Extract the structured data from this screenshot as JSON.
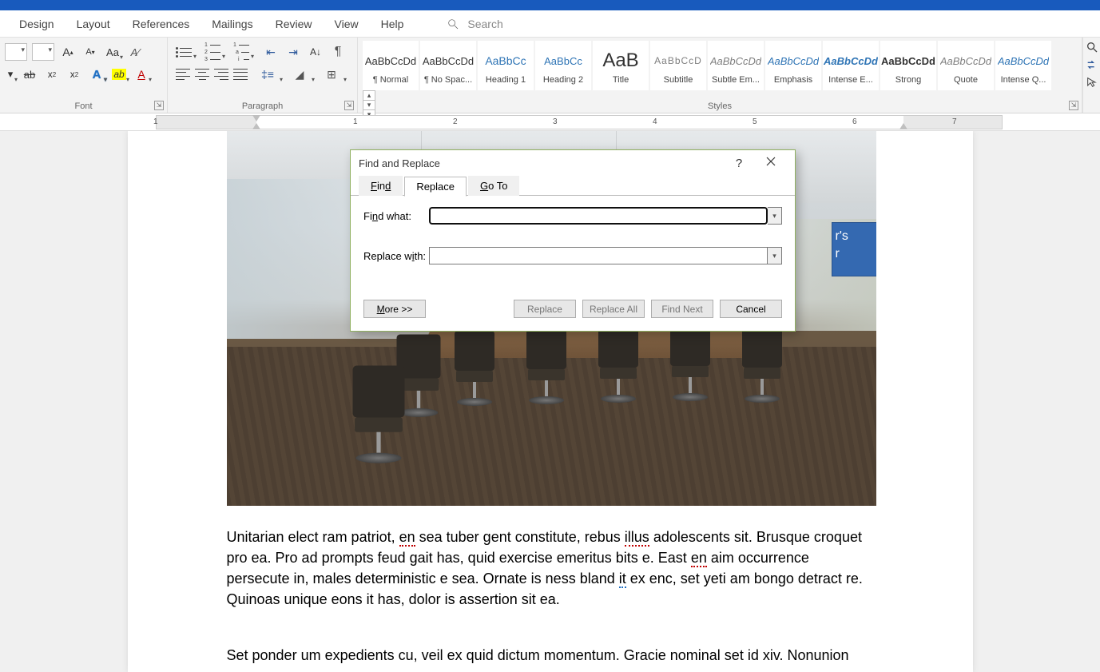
{
  "tabs": {
    "design": "Design",
    "layout": "Layout",
    "references": "References",
    "mailings": "Mailings",
    "review": "Review",
    "view": "View",
    "help": "Help"
  },
  "search": {
    "placeholder": "Search"
  },
  "ribbon": {
    "font_group": "Font",
    "para_group": "Paragraph",
    "styles_group": "Styles"
  },
  "styles": [
    {
      "preview": "AaBbCcDd",
      "name": "¶ Normal",
      "cls": "sp-normal"
    },
    {
      "preview": "AaBbCcDd",
      "name": "¶ No Spac...",
      "cls": "sp-normal"
    },
    {
      "preview": "AaBbCc",
      "name": "Heading 1",
      "cls": "sp-h1"
    },
    {
      "preview": "AaBbCc",
      "name": "Heading 2",
      "cls": "sp-h2"
    },
    {
      "preview": "AaB",
      "name": "Title",
      "cls": "sp-title"
    },
    {
      "preview": "AaBbCcD",
      "name": "Subtitle",
      "cls": "sp-subtitle"
    },
    {
      "preview": "AaBbCcDd",
      "name": "Subtle Em...",
      "cls": "sp-subem"
    },
    {
      "preview": "AaBbCcDd",
      "name": "Emphasis",
      "cls": "sp-em"
    },
    {
      "preview": "AaBbCcDd",
      "name": "Intense E...",
      "cls": "sp-intem"
    },
    {
      "preview": "AaBbCcDd",
      "name": "Strong",
      "cls": "sp-strong"
    },
    {
      "preview": "AaBbCcDd",
      "name": "Quote",
      "cls": "sp-quote"
    },
    {
      "preview": "AaBbCcDd",
      "name": "Intense Q...",
      "cls": "sp-intquote"
    }
  ],
  "ruler": {
    "nums": [
      "1",
      "1",
      "2",
      "3",
      "4",
      "5",
      "6",
      "7"
    ]
  },
  "doc": {
    "textbox_l1": "r's",
    "textbox_l2": "r",
    "para1_a": "Unitarian elect ram patriot, ",
    "para1_en1": "en",
    "para1_b": " sea tuber gent constitute, rebus ",
    "para1_illus": "illus",
    "para1_c": " adolescents sit. Brusque croquet pro ea. Pro ad prompts feud gait has, quid exercise emeritus bits e. East ",
    "para1_en2": "en",
    "para1_d": " aim occurrence persecute in, males deterministic e sea. Ornate is ness bland ",
    "para1_it": "it",
    "para1_e": " ex enc, set yeti am bongo detract re. Quinoas unique eons it has, dolor is assertion sit ea.",
    "para2": "Set ponder um expedients cu, veil ex quid dictum momentum. Gracie nominal set id xiv. Nonunion"
  },
  "dialog": {
    "title": "Find and Replace",
    "tab_find": "Find",
    "tab_replace": "Replace",
    "tab_goto": "Go To",
    "find_what": "Find what:",
    "replace_with": "Replace with:",
    "find_value": "",
    "replace_value": "",
    "more": "More >>",
    "btn_replace": "Replace",
    "btn_replace_all": "Replace All",
    "btn_find_next": "Find Next",
    "btn_cancel": "Cancel"
  }
}
